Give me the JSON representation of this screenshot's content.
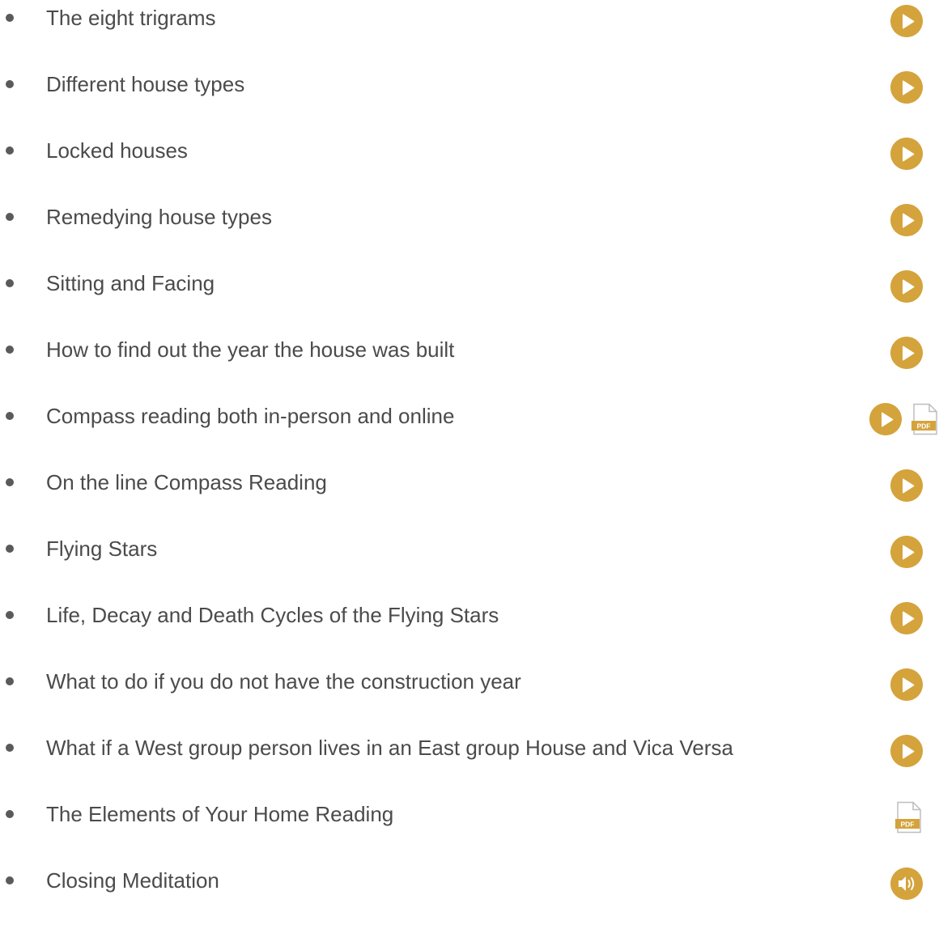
{
  "colors": {
    "accent": "#d4a33c",
    "text": "#4b4b4b"
  },
  "lessons": [
    {
      "title": "The eight trigrams",
      "media": [
        "play"
      ]
    },
    {
      "title": "Different house types",
      "media": [
        "play"
      ]
    },
    {
      "title": "Locked houses",
      "media": [
        "play"
      ]
    },
    {
      "title": "Remedying house types",
      "media": [
        "play"
      ]
    },
    {
      "title": "Sitting and Facing",
      "media": [
        "play"
      ]
    },
    {
      "title": "How to find out the year the house was built",
      "media": [
        "play"
      ]
    },
    {
      "title": "Compass reading both in-person and online",
      "media": [
        "play",
        "pdf"
      ]
    },
    {
      "title": "On the line Compass Reading",
      "media": [
        "play"
      ]
    },
    {
      "title": "Flying Stars",
      "media": [
        "play"
      ]
    },
    {
      "title": "Life, Decay and Death Cycles of the Flying Stars",
      "media": [
        "play"
      ]
    },
    {
      "title": "What to do if you do not have the construction year",
      "media": [
        "play"
      ]
    },
    {
      "title": "What if a West group person lives in an East group House and Vica Versa",
      "media": [
        "play"
      ]
    },
    {
      "title": "The Elements of Your Home Reading",
      "media": [
        "pdf"
      ]
    },
    {
      "title": "Closing Meditation",
      "media": [
        "audio"
      ]
    }
  ],
  "icons": {
    "play": "play-icon",
    "pdf": "pdf-icon",
    "audio": "audio-icon"
  },
  "pdf_label": "PDF"
}
